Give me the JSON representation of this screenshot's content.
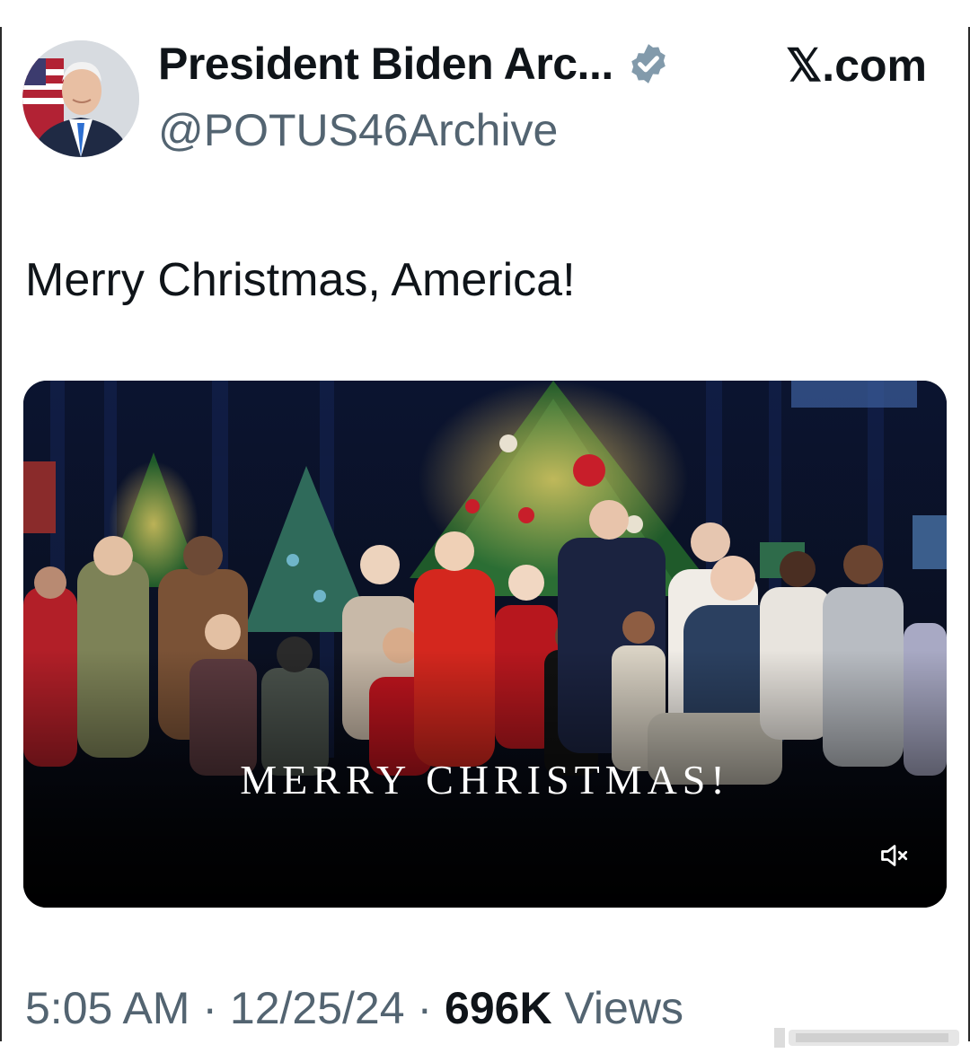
{
  "author": {
    "display_name": "President Biden Arc...",
    "handle": "@POTUS46Archive",
    "avatar_icon": "profile-photo",
    "verified_icon": "verified-badge-icon",
    "verified_color": "#829aab"
  },
  "site_label": "𝕏.com",
  "post": {
    "text": "Merry Christmas, America!",
    "media": {
      "caption": "MERRY CHRISTMAS!",
      "mute_icon": "speaker-muted-icon"
    }
  },
  "meta": {
    "time": "5:05 AM",
    "separator": "·",
    "date": "12/25/24",
    "views_count": "696K",
    "views_label": "Views"
  },
  "colors": {
    "text_primary": "#0f1419",
    "text_secondary": "#536471",
    "media_background": "#060a14"
  }
}
